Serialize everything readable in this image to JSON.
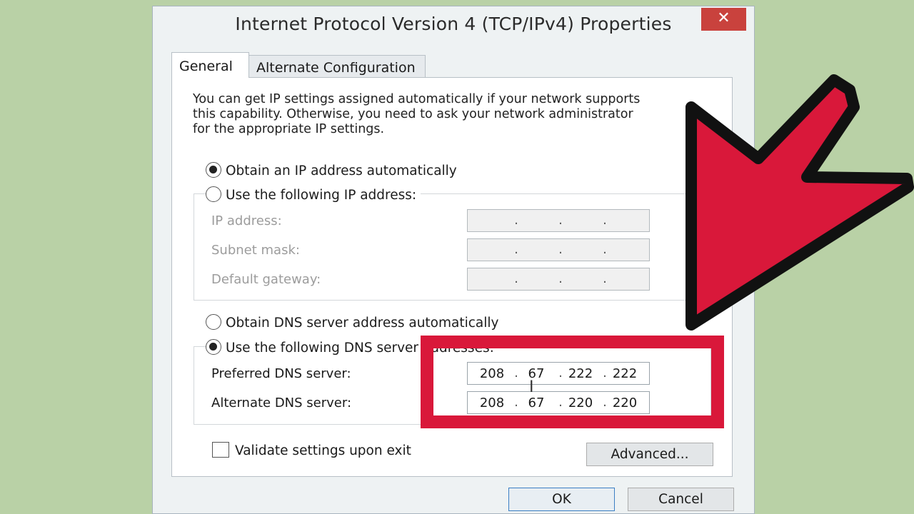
{
  "window": {
    "title": "Internet Protocol Version 4 (TCP/IPv4) Properties",
    "close_glyph": "✕"
  },
  "tabs": [
    {
      "label": "General",
      "active": true
    },
    {
      "label": "Alternate Configuration",
      "active": false
    }
  ],
  "intro_text": "You can get IP settings assigned automatically if your network supports\nthis capability. Otherwise, you need to ask your network administrator\nfor the appropriate IP settings.",
  "ip_section": {
    "auto_label": "Obtain an IP address automatically",
    "auto_selected": true,
    "manual_label": "Use the following IP address:",
    "manual_selected": false,
    "fields": [
      {
        "label": "IP address:",
        "value": [
          "",
          "",
          "",
          ""
        ]
      },
      {
        "label": "Subnet mask:",
        "value": [
          "",
          "",
          "",
          ""
        ]
      },
      {
        "label": "Default gateway:",
        "value": [
          "",
          "",
          "",
          ""
        ]
      }
    ]
  },
  "dns_section": {
    "auto_label": "Obtain DNS server address automatically",
    "auto_selected": false,
    "manual_label": "Use the following DNS server addresses:",
    "manual_selected": true,
    "preferred": {
      "label": "Preferred DNS server:",
      "octets": [
        "208",
        "67",
        "222",
        "222"
      ]
    },
    "alternate": {
      "label": "Alternate DNS server:",
      "octets": [
        "208",
        "67",
        "220",
        "220"
      ]
    }
  },
  "validate_label": "Validate settings upon exit",
  "validate_checked": false,
  "buttons": {
    "advanced": "Advanced...",
    "ok": "OK",
    "cancel": "Cancel"
  },
  "colors": {
    "background": "#b9d1a6",
    "annotation_red": "#d9183a",
    "close_button": "#c9423d"
  },
  "annotations": {
    "arrow_icon": "arrow-pointing-down-left",
    "highlight": "red-rectangle-around-dns-fields"
  }
}
